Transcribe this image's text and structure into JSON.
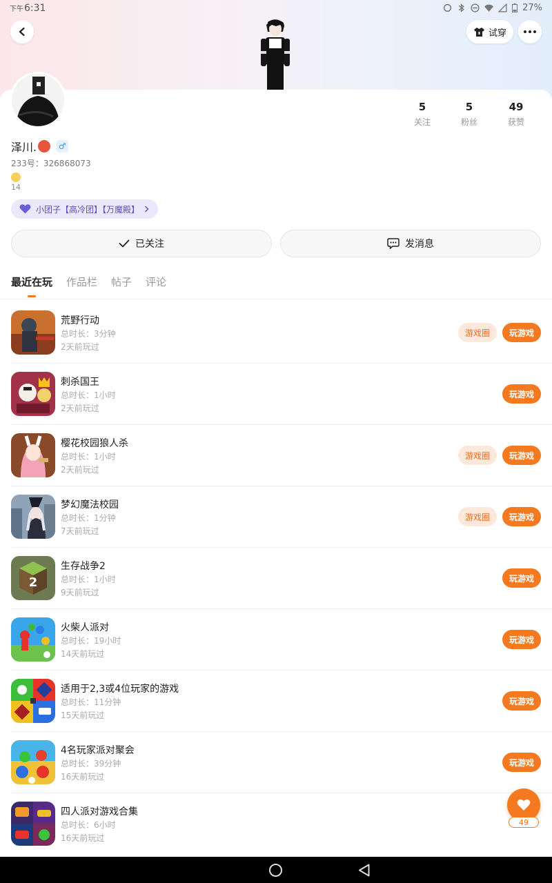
{
  "status_bar": {
    "ampm": "下午",
    "time": "6:31",
    "battery": "27%"
  },
  "header": {
    "try_label": "试穿"
  },
  "profile": {
    "name": "泽川.",
    "gender_symbol": "♂",
    "uid": "233号：326868073",
    "small_count": "14",
    "tag": "小团子【高冷团】【万魔殿】",
    "stats": [
      {
        "value": "5",
        "label": "关注"
      },
      {
        "value": "5",
        "label": "粉丝"
      },
      {
        "value": "49",
        "label": "获赞"
      }
    ]
  },
  "actions": {
    "follow_label": "已关注",
    "message_label": "发消息"
  },
  "tabs": [
    {
      "label": "最近在玩"
    },
    {
      "label": "作品栏"
    },
    {
      "label": "帖子"
    },
    {
      "label": "评论"
    }
  ],
  "games": [
    {
      "title": "荒野行动",
      "duration": "总时长：3分钟",
      "last_played": "2天前玩过",
      "circle_label": "游戏圈",
      "play_label": "玩游戏"
    },
    {
      "title": "刺杀国王",
      "duration": "总时长：1小时",
      "last_played": "2天前玩过",
      "play_label": "玩游戏"
    },
    {
      "title": "樱花校园狼人杀",
      "duration": "总时长：1小时",
      "last_played": "2天前玩过",
      "circle_label": "游戏圈",
      "play_label": "玩游戏"
    },
    {
      "title": "梦幻魔法校园",
      "duration": "总时长：1分钟",
      "last_played": "7天前玩过",
      "circle_label": "游戏圈",
      "play_label": "玩游戏"
    },
    {
      "title": "生存战争2",
      "duration": "总时长：1小时",
      "last_played": "9天前玩过",
      "play_label": "玩游戏"
    },
    {
      "title": "火柴人派对",
      "duration": "总时长：19小时",
      "last_played": "14天前玩过",
      "play_label": "玩游戏"
    },
    {
      "title": "适用于2,3或4位玩家的游戏",
      "duration": "总时长：11分钟",
      "last_played": "15天前玩过",
      "play_label": "玩游戏"
    },
    {
      "title": "4名玩家派对聚会",
      "duration": "总时长：39分钟",
      "last_played": "16天前玩过",
      "play_label": "玩游戏"
    },
    {
      "title": "四人派对游戏合集",
      "duration": "总时长：6小时",
      "last_played": "16天前玩过"
    }
  ],
  "fab": {
    "count": "49"
  },
  "colors": {
    "accent": "#f4791f",
    "circle_bg": "#fde8dc",
    "tag_bg": "#ebe8fb",
    "tag_text": "#5a4fbf"
  }
}
